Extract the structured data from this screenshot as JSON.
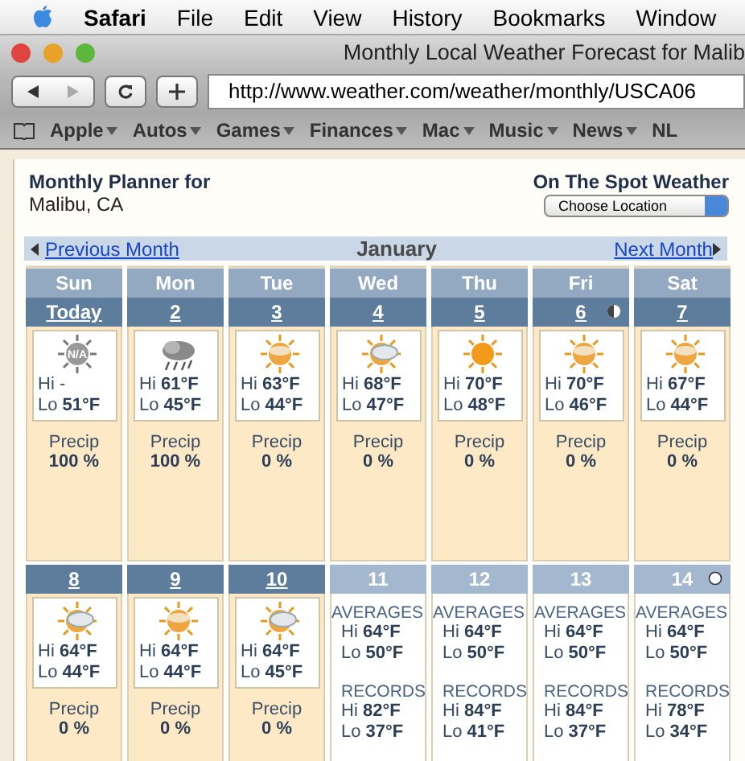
{
  "menu_bar": {
    "app": "Safari",
    "items": [
      "File",
      "Edit",
      "View",
      "History",
      "Bookmarks",
      "Window"
    ]
  },
  "window": {
    "title": "Monthly Local Weather Forecast for Malib"
  },
  "address_bar": {
    "value": "http://www.weather.com/weather/monthly/USCA06"
  },
  "bookmarks": [
    {
      "label": "Apple",
      "menu": true
    },
    {
      "label": "Autos",
      "menu": true
    },
    {
      "label": "Games",
      "menu": true
    },
    {
      "label": "Finances",
      "menu": true
    },
    {
      "label": "Mac",
      "menu": true
    },
    {
      "label": "Music",
      "menu": true
    },
    {
      "label": "News",
      "menu": true
    },
    {
      "label": "NL",
      "menu": false
    }
  ],
  "page": {
    "planner_title": "Monthly Planner for",
    "location": "Malibu, CA",
    "spot_title": "On The Spot Weather",
    "location_select": "Choose Location",
    "previous_month": "Previous Month",
    "month": "January",
    "next_month": "Next Month"
  },
  "day_names": [
    "Sun",
    "Mon",
    "Tue",
    "Wed",
    "Thu",
    "Fri",
    "Sat"
  ],
  "weeks": [
    [
      {
        "kind": "forecast",
        "date": "Today",
        "sky": {
          "kind": "unknown",
          "label": "N/A"
        },
        "hi": "Hi -",
        "lo": "Lo **51°F**",
        "precip_label": "Precip",
        "precip": "100 %"
      },
      {
        "kind": "forecast",
        "date": "2",
        "sky": {
          "kind": "rain"
        },
        "hi": "Hi **61°F**",
        "lo": "Lo **45°F**",
        "precip_label": "Precip",
        "precip": "100 %"
      },
      {
        "kind": "forecast",
        "date": "3",
        "sky": {
          "kind": "haze"
        },
        "hi": "Hi **63°F**",
        "lo": "Lo **44°F**",
        "precip_label": "Precip",
        "precip": "0 %"
      },
      {
        "kind": "forecast",
        "date": "4",
        "sky": {
          "kind": "cloud"
        },
        "hi": "Hi **68°F**",
        "lo": "Lo **47°F**",
        "precip_label": "Precip",
        "precip": "0 %"
      },
      {
        "kind": "forecast",
        "date": "5",
        "sky": {
          "kind": "sun"
        },
        "hi": "Hi **70°F**",
        "lo": "Lo **48°F**",
        "precip_label": "Precip",
        "precip": "0 %"
      },
      {
        "kind": "forecast",
        "date": "6",
        "moon": {
          "kind": "half"
        },
        "sky": {
          "kind": "haze"
        },
        "hi": "Hi **70°F**",
        "lo": "Lo **46°F**",
        "precip_label": "Precip",
        "precip": "0 %"
      },
      {
        "kind": "forecast",
        "date": "7",
        "sky": {
          "kind": "haze"
        },
        "hi": "Hi **67°F**",
        "lo": "Lo **44°F**",
        "precip_label": "Precip",
        "precip": "0 %"
      }
    ],
    [
      {
        "kind": "forecast",
        "date": "8",
        "sky": {
          "kind": "cloud"
        },
        "hi": "Hi **64°F**",
        "lo": "Lo **44°F**",
        "precip_label": "Precip",
        "precip": "0 %"
      },
      {
        "kind": "forecast",
        "date": "9",
        "sky": {
          "kind": "haze"
        },
        "hi": "Hi **64°F**",
        "lo": "Lo **44°F**",
        "precip_label": "Precip",
        "precip": "0 %"
      },
      {
        "kind": "forecast",
        "date": "10",
        "sky": {
          "kind": "cloud"
        },
        "hi": "Hi **64°F**",
        "lo": "Lo **45°F**",
        "precip_label": "Precip",
        "precip": "0 %"
      },
      {
        "kind": "averages",
        "date": "11",
        "averages": {
          "label": "AVERAGES",
          "hi": "Hi **64°F**",
          "lo": "Lo **50°F**"
        },
        "records": {
          "label": "RECORDS",
          "hi": "Hi **82°F**",
          "lo": "Lo **37°F**"
        }
      },
      {
        "kind": "averages",
        "date": "12",
        "averages": {
          "label": "AVERAGES",
          "hi": "Hi **64°F**",
          "lo": "Lo **50°F**"
        },
        "records": {
          "label": "RECORDS",
          "hi": "Hi **84°F**",
          "lo": "Lo **41°F**"
        }
      },
      {
        "kind": "averages",
        "date": "13",
        "averages": {
          "label": "AVERAGES",
          "hi": "Hi **64°F**",
          "lo": "Lo **50°F**"
        },
        "records": {
          "label": "RECORDS",
          "hi": "Hi **84°F**",
          "lo": "Lo **37°F**"
        }
      },
      {
        "kind": "averages",
        "date": "14",
        "moon": {
          "kind": "full"
        },
        "averages": {
          "label": "AVERAGES",
          "hi": "Hi **64°F**",
          "lo": "Lo **50°F**"
        },
        "records": {
          "label": "RECORDS",
          "hi": "Hi **78°F**",
          "lo": "Lo **34°F**"
        }
      }
    ]
  ]
}
